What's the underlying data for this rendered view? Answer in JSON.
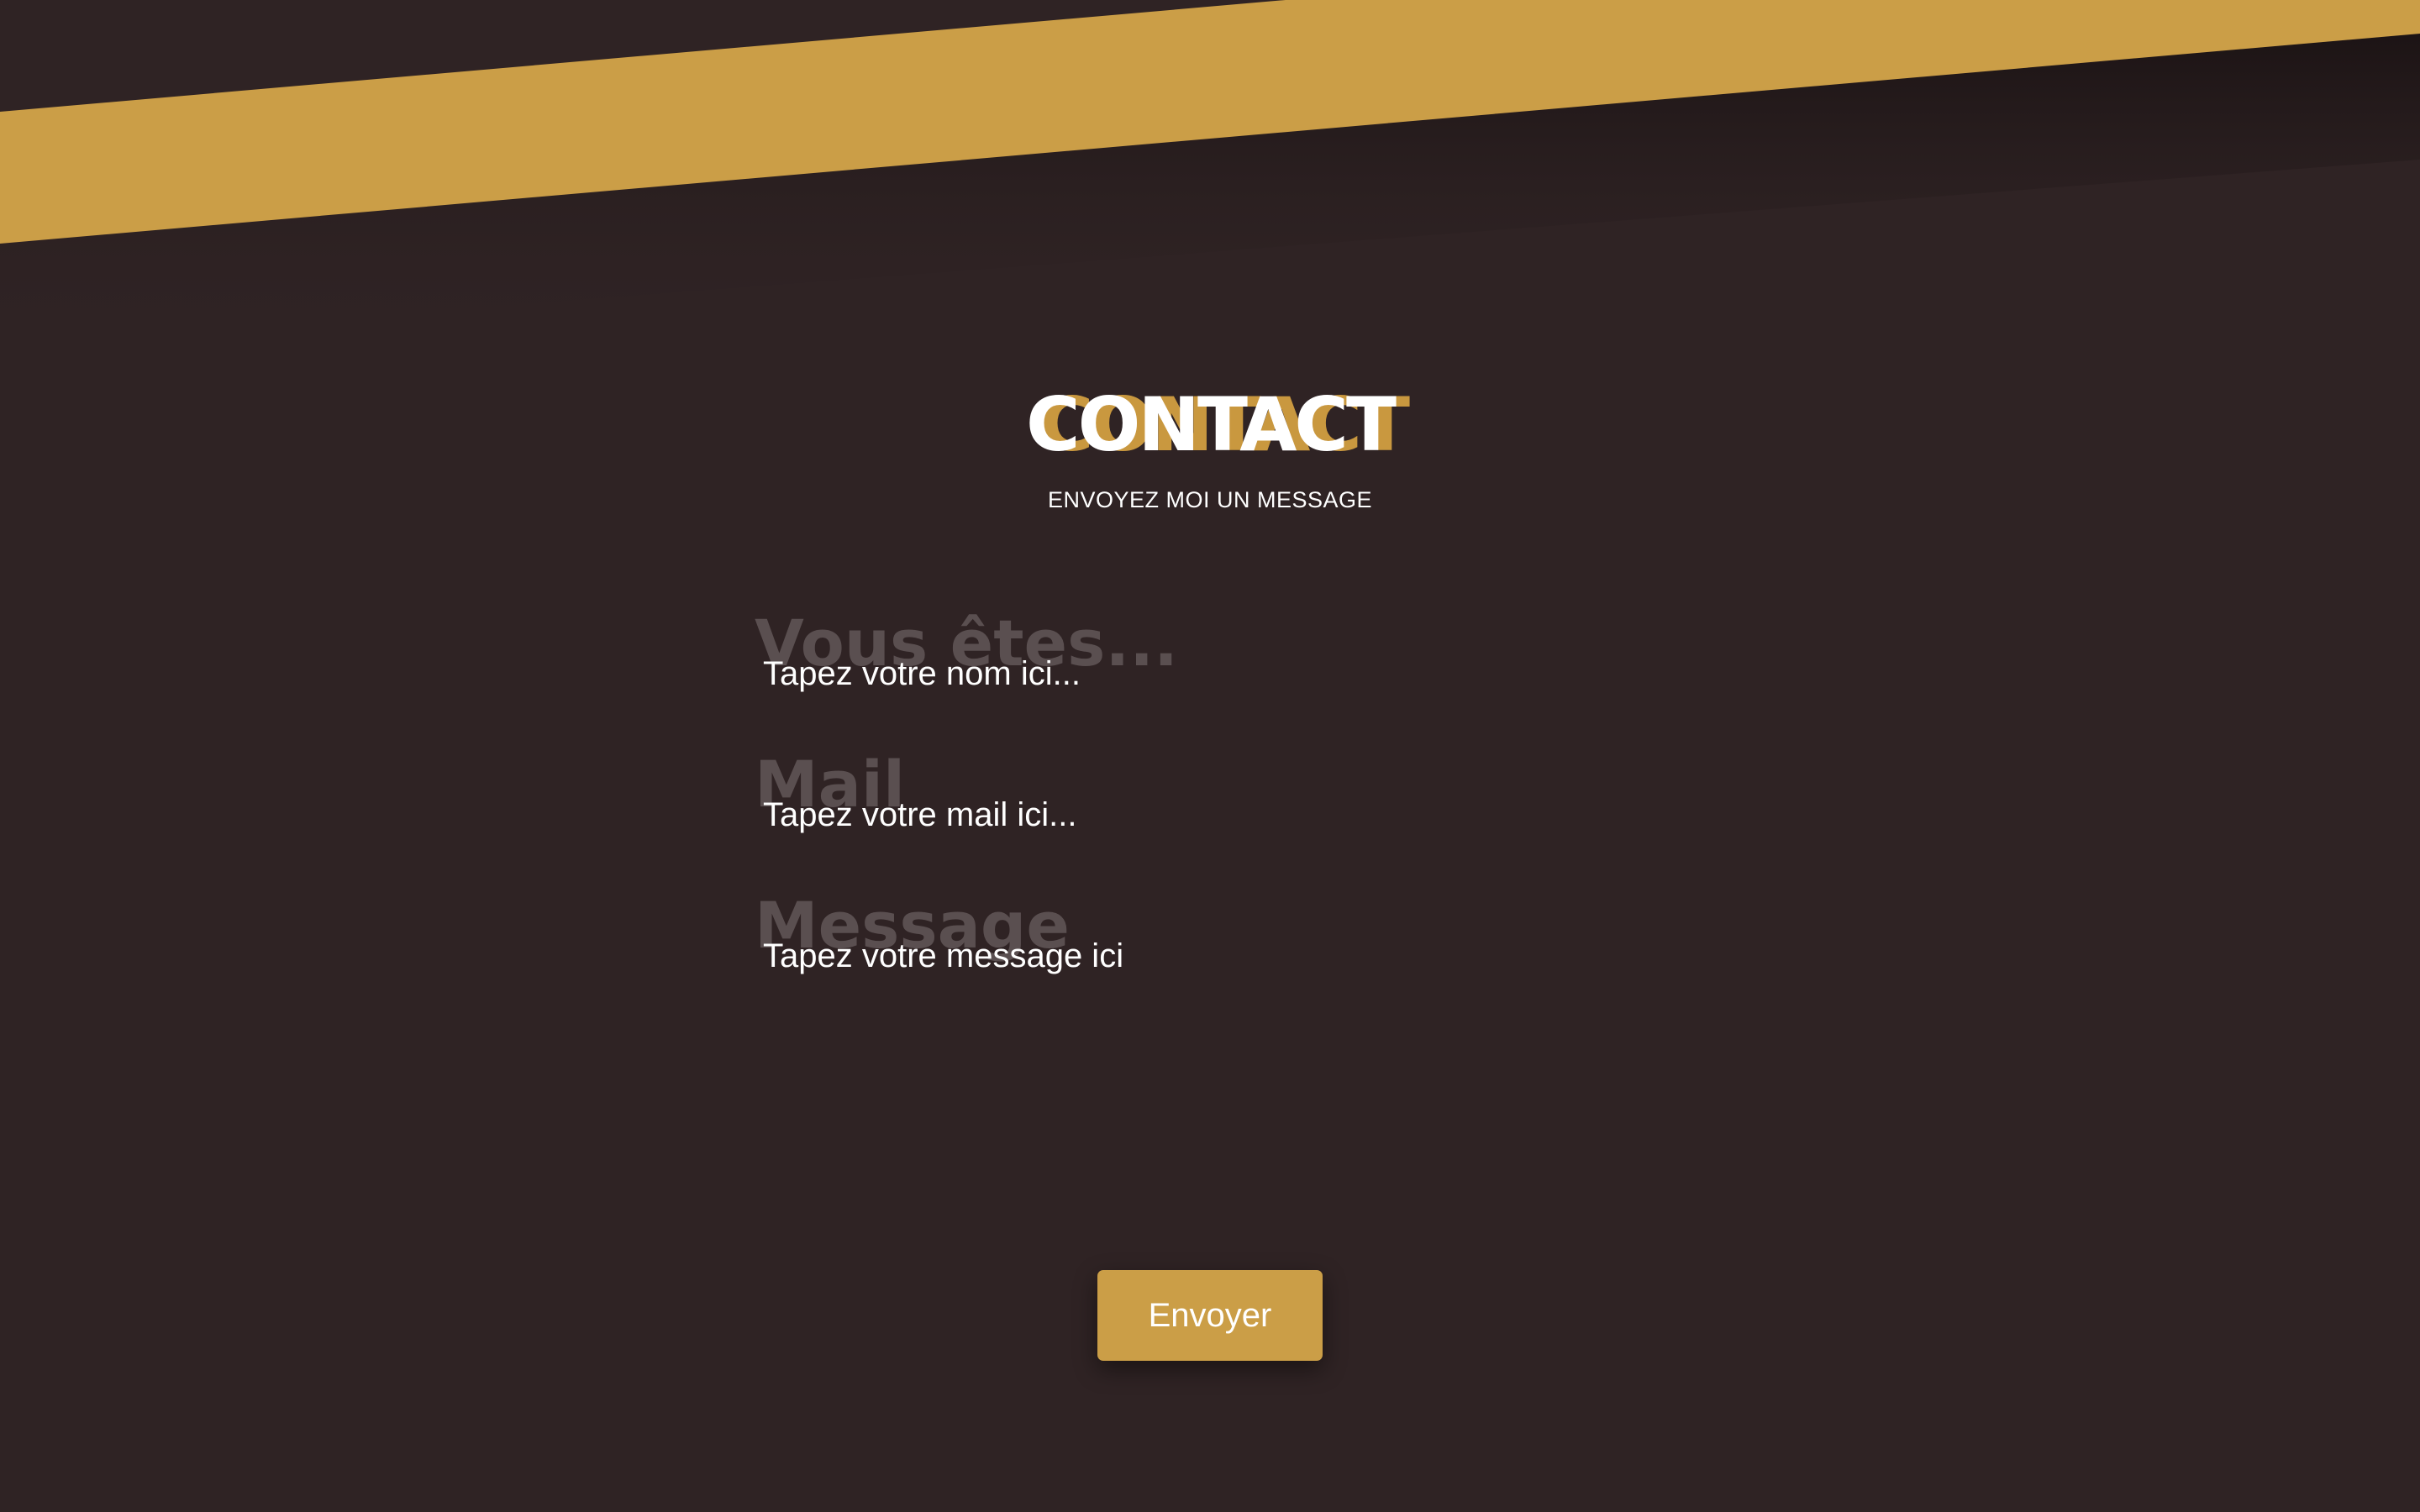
{
  "colors": {
    "background": "#2f2324",
    "accent": "#cb9e47",
    "label_muted": "#5a4f50",
    "text": "#ffffff"
  },
  "header": {
    "title": "CONTACT",
    "subtitle": "ENVOYEZ MOI UN MESSAGE"
  },
  "form": {
    "name": {
      "label": "Vous êtes...",
      "placeholder": "Tapez votre nom ici..."
    },
    "mail": {
      "label": "Mail",
      "placeholder": "Tapez votre mail ici..."
    },
    "message": {
      "label": "Message",
      "placeholder": "Tapez votre message ici"
    },
    "submit_label": "Envoyer"
  }
}
